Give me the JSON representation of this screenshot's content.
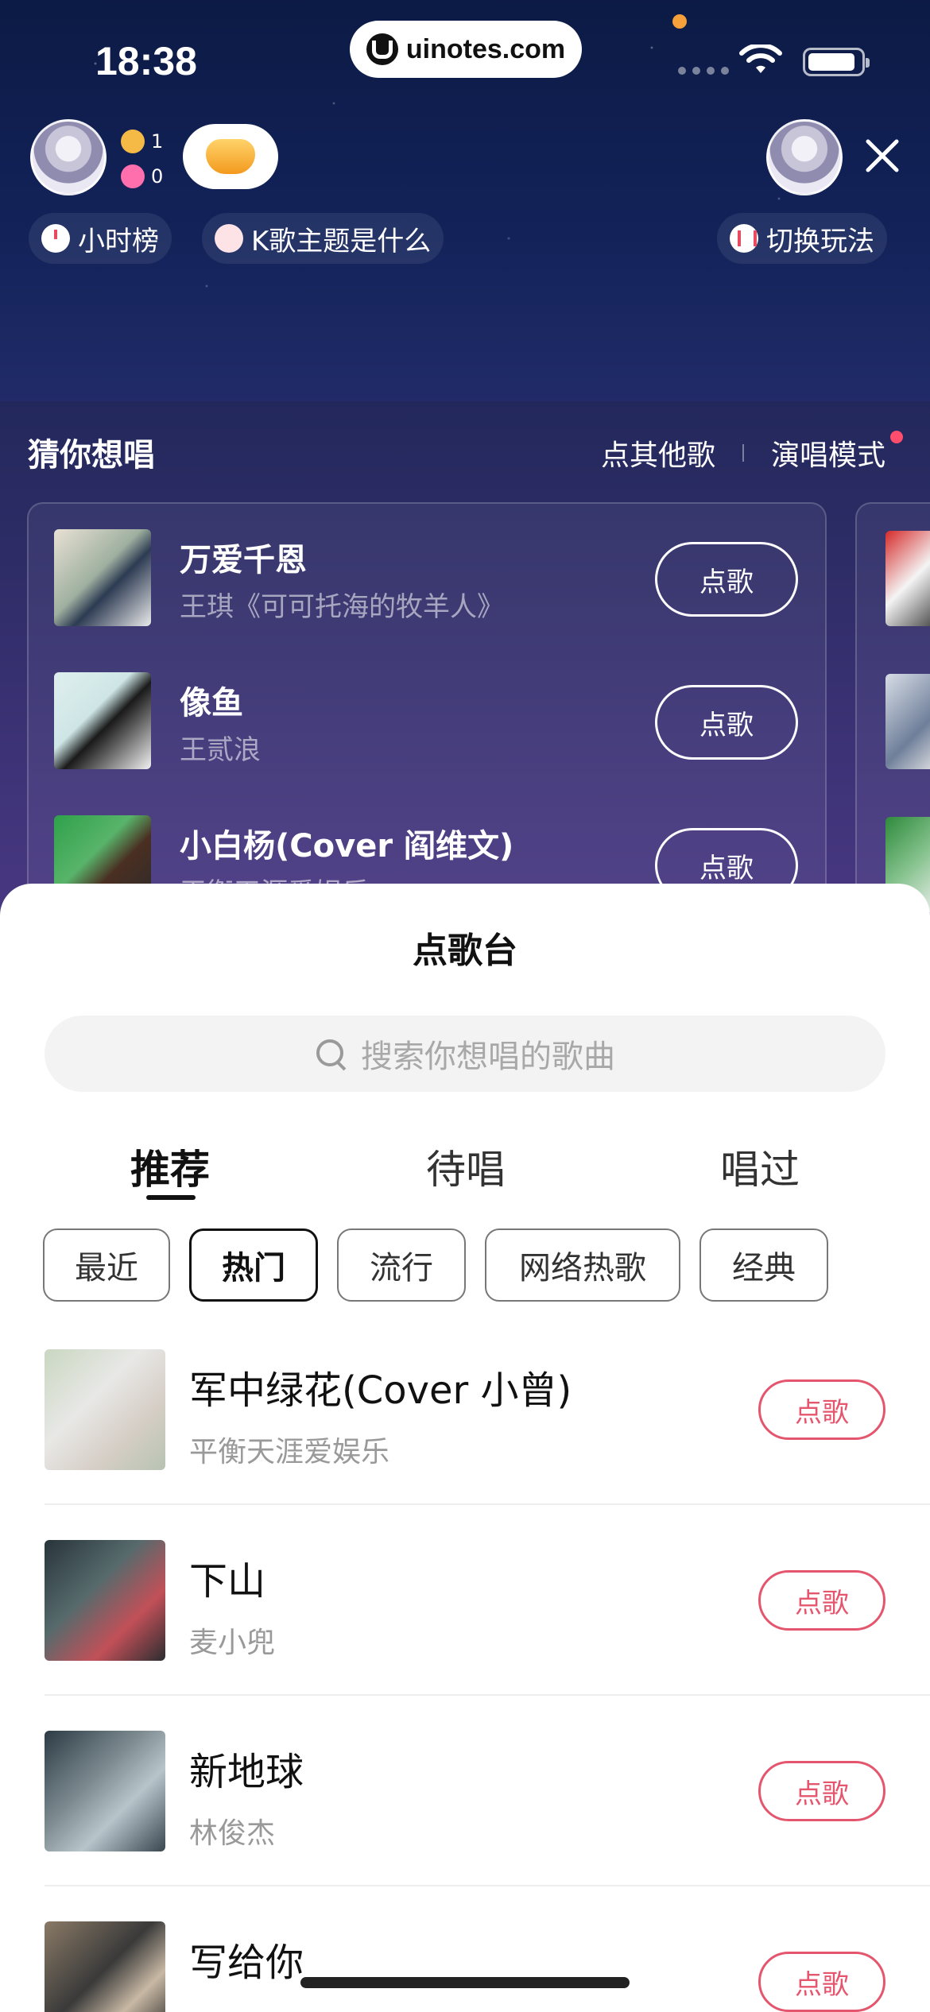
{
  "status": {
    "time": "18:38",
    "url": "uinotes.com"
  },
  "room": {
    "stat_users": "1",
    "stat_likes": "0",
    "chips": {
      "hour_rank": "小时榜",
      "topic": "K歌主题是什么",
      "switch_mode": "切换玩法"
    }
  },
  "guess": {
    "title": "猜你想唱",
    "other_songs": "点其他歌",
    "perform_mode": "演唱模式",
    "songs": [
      {
        "name": "万爱千恩",
        "artist": "王琪《可可托海的牧羊人》",
        "button": "点歌"
      },
      {
        "name": "像鱼",
        "artist": "王贰浪",
        "button": "点歌"
      },
      {
        "name": "小白杨(Cover 阎维文)",
        "artist": "平衡天涯爱娱乐",
        "button": "点歌"
      }
    ]
  },
  "sheet": {
    "title": "点歌台",
    "search_placeholder": "搜索你想唱的歌曲",
    "tabs": [
      "推荐",
      "待唱",
      "唱过"
    ],
    "active_tab": "推荐",
    "filters": [
      "最近",
      "热门",
      "流行",
      "网络热歌",
      "经典"
    ],
    "active_filter": "热门",
    "songs": [
      {
        "name": "军中绿花(Cover 小曾)",
        "artist": "平衡天涯爱娱乐",
        "button": "点歌"
      },
      {
        "name": "下山",
        "artist": "麦小兜",
        "button": "点歌"
      },
      {
        "name": "新地球",
        "artist": "林俊杰",
        "button": "点歌"
      },
      {
        "name": "写给你",
        "artist": "",
        "button": "点歌"
      }
    ]
  },
  "colors": {
    "accent": "#e5566e",
    "background_top": "#0c1a45",
    "background_bottom": "#6a4298"
  }
}
